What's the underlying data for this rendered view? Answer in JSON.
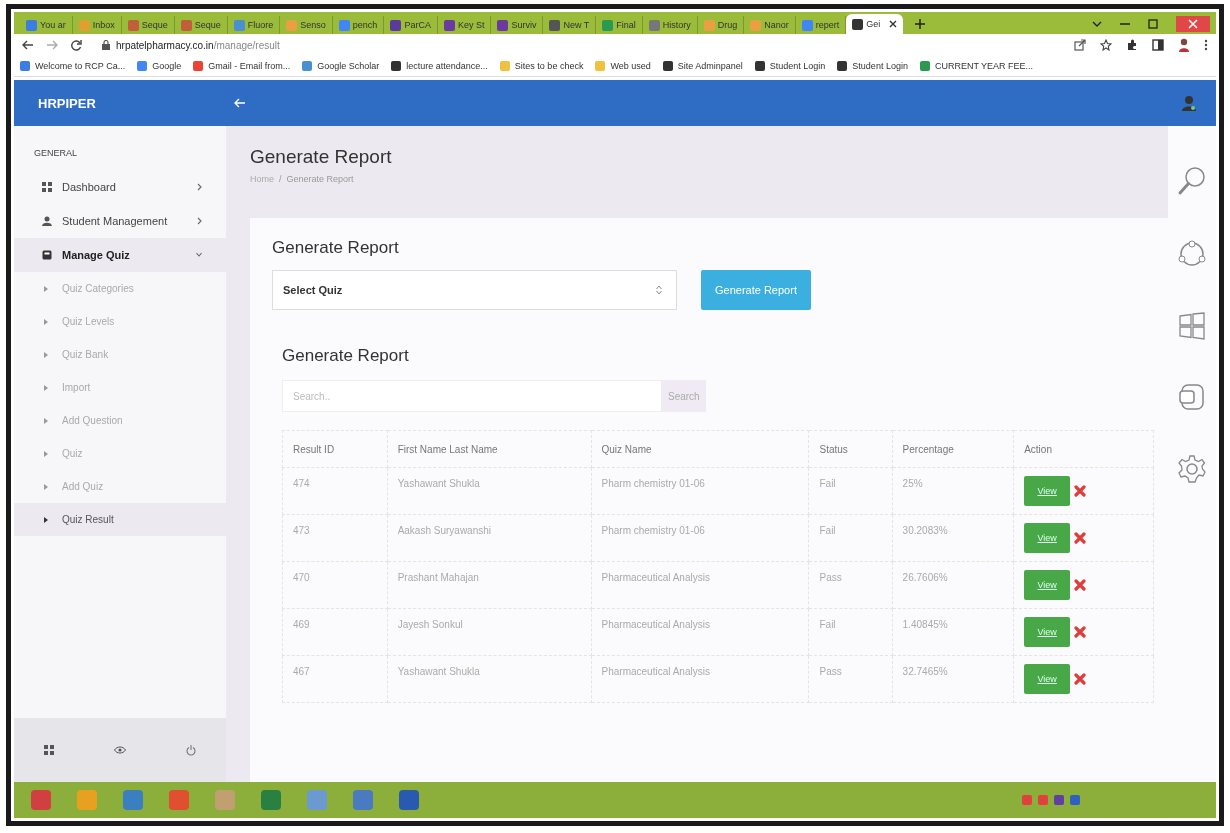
{
  "browser": {
    "tabs": [
      {
        "title": "You ar",
        "selected": false
      },
      {
        "title": "Inbox",
        "selected": false
      },
      {
        "title": "Seque",
        "selected": false
      },
      {
        "title": "Seque",
        "selected": false
      },
      {
        "title": "Fluore",
        "selected": false
      },
      {
        "title": "Senso",
        "selected": false
      },
      {
        "title": "pench",
        "selected": false
      },
      {
        "title": "ParCA",
        "selected": false
      },
      {
        "title": "Key St",
        "selected": false
      },
      {
        "title": "Surviv",
        "selected": false
      },
      {
        "title": "New T",
        "selected": false
      },
      {
        "title": "Final",
        "selected": false
      },
      {
        "title": "History",
        "selected": false
      },
      {
        "title": "Drug",
        "selected": false
      },
      {
        "title": "Nanor",
        "selected": false
      },
      {
        "title": "repert",
        "selected": false
      },
      {
        "title": "Gei",
        "selected": true
      }
    ],
    "address_host": "hrpatelpharmacy.co.in",
    "address_path": "/manage/result",
    "bookmarks": [
      "Welcome to RCP Ca...",
      "Google",
      "Gmail - Email from...",
      "Google Scholar",
      "lecture attendance...",
      "Sites to be check",
      "Web used",
      "Site Adminpanel",
      "Student Login",
      "Student Login",
      "CURRENT YEAR FEE..."
    ]
  },
  "app": {
    "brand": "HRPIPER"
  },
  "sidebar": {
    "section": "GENERAL",
    "items": [
      {
        "label": "Dashboard",
        "expanded": false
      },
      {
        "label": "Student Management",
        "expanded": false
      },
      {
        "label": "Manage Quiz",
        "expanded": true,
        "children": [
          {
            "label": "Quiz Categories",
            "selected": false
          },
          {
            "label": "Quiz Levels",
            "selected": false
          },
          {
            "label": "Quiz Bank",
            "selected": false
          },
          {
            "label": "Import",
            "selected": false
          },
          {
            "label": "Add Question",
            "selected": false
          },
          {
            "label": "Quiz",
            "selected": false
          },
          {
            "label": "Add Quiz",
            "selected": false
          },
          {
            "label": "Quiz Result",
            "selected": true
          }
        ]
      }
    ]
  },
  "page": {
    "title": "Generate Report",
    "breadcrumb": [
      "Home",
      "Generate Report"
    ],
    "breadcrumb_separator": "/",
    "form": {
      "title": "Generate Report",
      "select": "Select Quiz",
      "button": "Generate Report"
    },
    "report": {
      "title": "Generate Report",
      "search": {
        "placeholder": "Search..",
        "button": "Search"
      },
      "table": {
        "columns": [
          "Result ID",
          "First Name Last Name",
          "Quiz Name",
          "Status",
          "Percentage",
          "Action"
        ],
        "rows": [
          {
            "id": "474",
            "name": "Yashawant Shukla",
            "quiz": "Pharm chemistry 01-06",
            "status": "Fail",
            "percentage": "25%",
            "action": "View"
          },
          {
            "id": "473",
            "name": "Aakash Suryawanshi",
            "quiz": "Pharm chemistry 01-06",
            "status": "Fail",
            "percentage": "30.2083%",
            "action": "View"
          },
          {
            "id": "470",
            "name": "Prashant Mahajan",
            "quiz": "Pharmaceutical Analysis",
            "status": "Pass",
            "percentage": "26.7606%",
            "action": "View"
          },
          {
            "id": "469",
            "name": "Jayesh Sonkul",
            "quiz": "Pharmaceutical Analysis",
            "status": "Fail",
            "percentage": "1.40845%",
            "action": "View"
          },
          {
            "id": "467",
            "name": "Yashawant Shukla",
            "quiz": "Pharmaceutical Analysis",
            "status": "Pass",
            "percentage": "32.7465%",
            "action": "View"
          }
        ]
      }
    }
  }
}
